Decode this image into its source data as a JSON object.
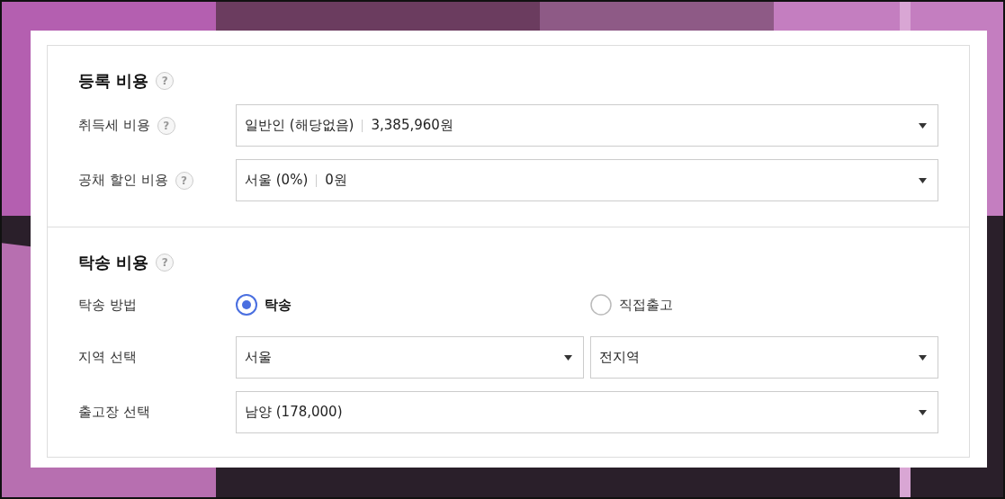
{
  "sections": [
    {
      "title": "등록 비용",
      "help": "?",
      "rows": [
        {
          "kind": "select",
          "label": "취득세 비용",
          "help": "?",
          "selects": [
            {
              "parts": [
                "일반인 (해당없음)",
                "3,385,960원"
              ]
            }
          ]
        },
        {
          "kind": "select",
          "label": "공채 할인 비용",
          "help": "?",
          "selects": [
            {
              "parts": [
                "서울 (0%)",
                "0원"
              ]
            }
          ]
        }
      ]
    },
    {
      "title": "탁송 비용",
      "help": "?",
      "rows": [
        {
          "kind": "radio",
          "label": "탁송 방법",
          "options": [
            {
              "label": "탁송",
              "selected": true
            },
            {
              "label": "직접출고",
              "selected": false
            }
          ]
        },
        {
          "kind": "select",
          "label": "지역 선택",
          "selects": [
            {
              "parts": [
                "서울"
              ]
            },
            {
              "parts": [
                "전지역"
              ]
            }
          ]
        },
        {
          "kind": "select",
          "label": "출고장 선택",
          "selects": [
            {
              "parts": [
                "남양 (178,000)"
              ]
            }
          ]
        }
      ]
    }
  ]
}
